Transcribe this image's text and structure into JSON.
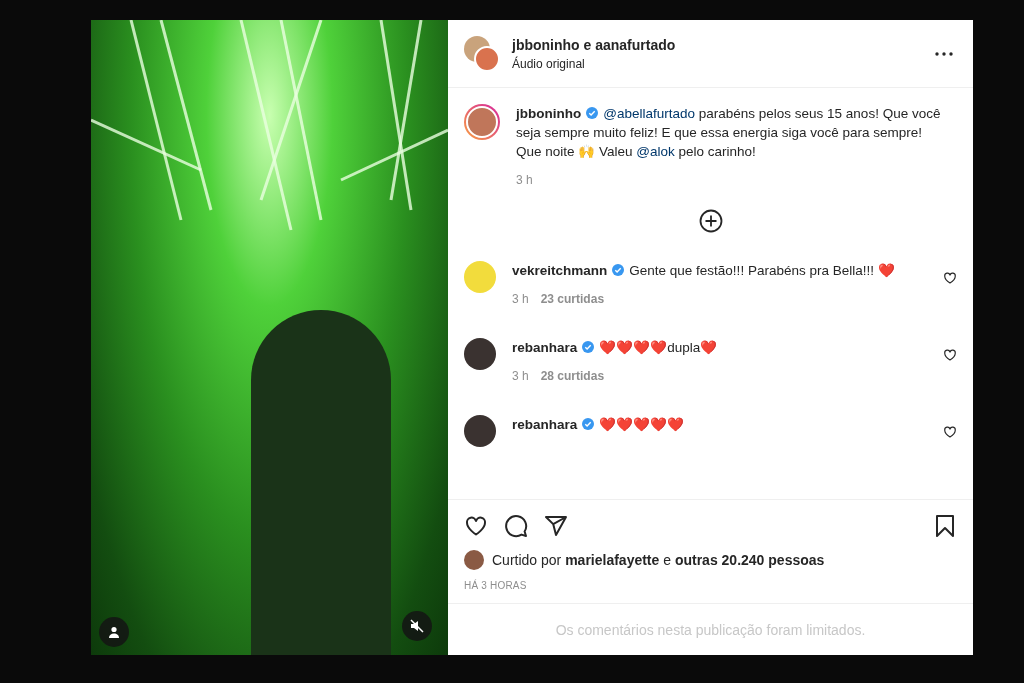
{
  "post": {
    "title": "jbboninho e aanafurtado",
    "subtitle": "Áudio original"
  },
  "caption": {
    "author": "jbboninho",
    "verified": true,
    "time": "3 h",
    "parts": [
      {
        "kind": "mention",
        "text": "@abellafurtado"
      },
      {
        "kind": "text",
        "text": " parabéns pelos seus 15 anos! Que você seja sempre muito feliz! E que essa energia siga você para sempre! Que noite 🙌 Valeu "
      },
      {
        "kind": "mention",
        "text": "@alok"
      },
      {
        "kind": "text",
        "text": " pelo carinho!"
      }
    ]
  },
  "comments": [
    {
      "author": "vekreitchmann",
      "verified": true,
      "text": "Gente que festão!!! Parabéns pra Bella!!! ❤️",
      "time": "3 h",
      "likes": "23 curtidas"
    },
    {
      "author": "rebanhara",
      "verified": true,
      "text": "❤️❤️❤️❤️dupla❤️",
      "time": "3 h",
      "likes": "28 curtidas"
    },
    {
      "author": "rebanhara",
      "verified": true,
      "text": "❤️❤️❤️❤️❤️"
    }
  ],
  "liked_by": "Curtido por **marielafayette** e **outras 20.240 pessoas**",
  "date": "HÁ 3 HORAS",
  "comments_notice": "Os comentários nesta publicação foram limitados."
}
